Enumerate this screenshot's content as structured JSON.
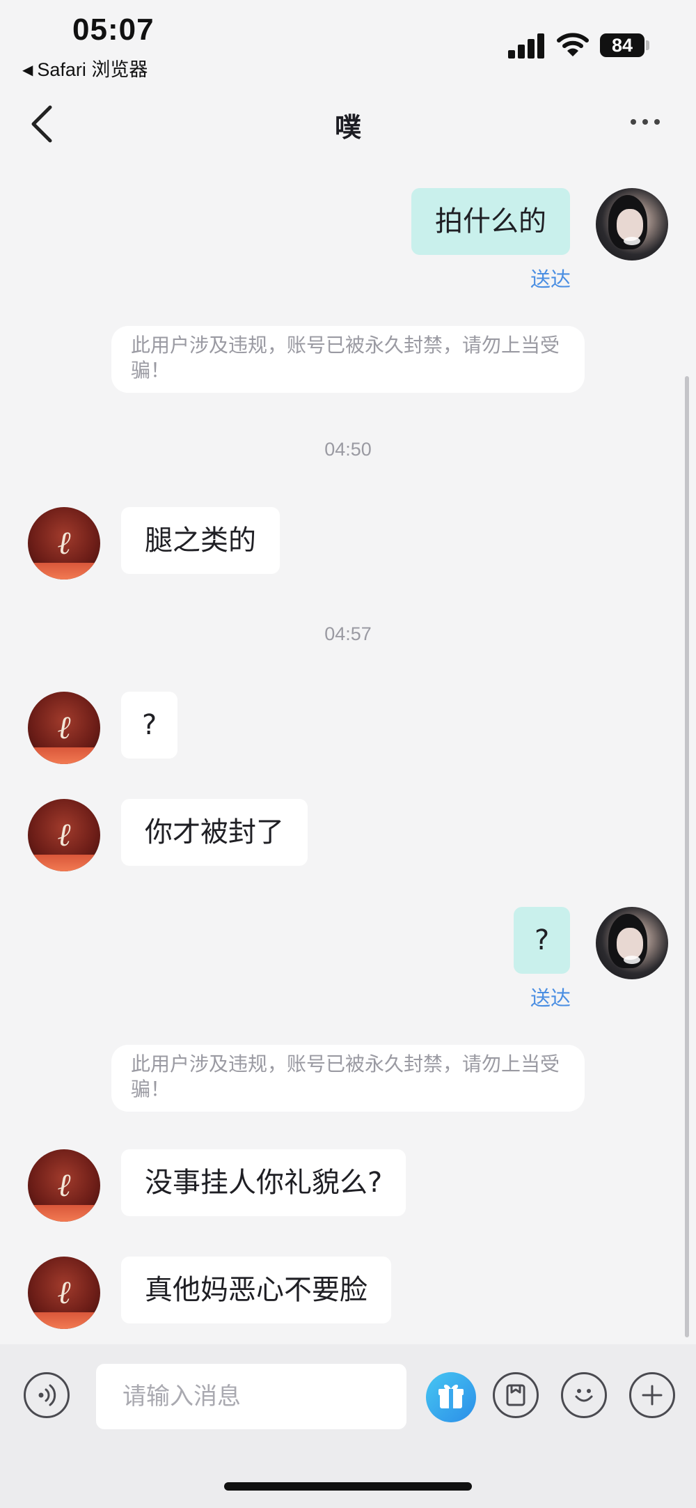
{
  "status_bar": {
    "time": "05:07",
    "back_app": "Safari 浏览器",
    "battery": "84"
  },
  "nav": {
    "title": "噗"
  },
  "messages": {
    "m1": {
      "text": "拍什么的",
      "status": "送达"
    },
    "notice1": "此用户涉及违规，账号已被永久封禁，请勿上当受骗！",
    "ts1": "04:50",
    "m2": {
      "text": "腿之类的"
    },
    "ts2": "04:57",
    "m3": {
      "text": "?"
    },
    "m4": {
      "text": "你才被封了"
    },
    "m5": {
      "text": "?",
      "status": "送达"
    },
    "notice2": "此用户涉及违规，账号已被永久封禁，请勿上当受骗！",
    "m6": {
      "text": "没事挂人你礼貌么?"
    },
    "m7": {
      "text": "真他妈恶心不要脸"
    }
  },
  "input": {
    "placeholder": "请输入消息"
  },
  "colors": {
    "outgoing_bubble": "#c9f0ec",
    "delivered": "#4a8ee2",
    "gift": "#2b8ee8"
  }
}
